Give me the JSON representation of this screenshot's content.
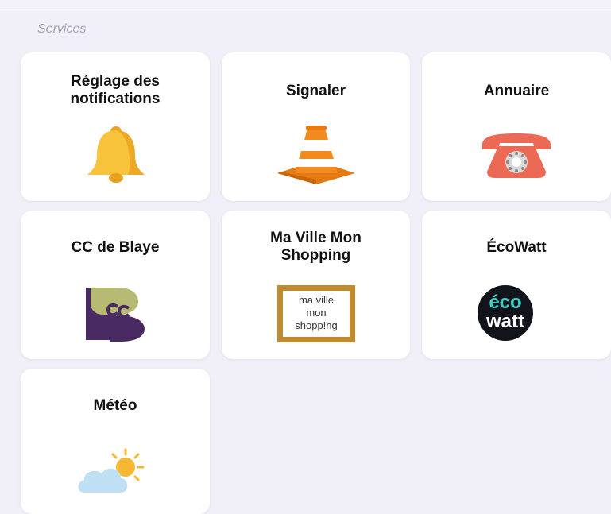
{
  "section": {
    "title": "Services"
  },
  "cards": [
    {
      "id": "notifications",
      "title_line1": "Réglage des",
      "title_line2": "notifications",
      "icon": "bell-icon"
    },
    {
      "id": "signaler",
      "title": "Signaler",
      "icon": "traffic-cone-icon"
    },
    {
      "id": "annuaire",
      "title": "Annuaire",
      "icon": "telephone-icon"
    },
    {
      "id": "cc-blaye",
      "title": "CC de Blaye",
      "icon": "cc-blaye-logo"
    },
    {
      "id": "ma-ville",
      "title_line1": "Ma Ville Mon",
      "title_line2": "Shopping",
      "icon": "ma-ville-mon-shopping-logo",
      "logo_lines": [
        "ma ville",
        "mon",
        "shopp!ng"
      ]
    },
    {
      "id": "ecowatt",
      "title": "ÉcoWatt",
      "icon": "ecowatt-logo",
      "logo_lines": [
        "éco",
        "watt"
      ]
    },
    {
      "id": "meteo",
      "title": "Météo",
      "icon": "weather-sun-cloud-icon"
    }
  ],
  "colors": {
    "background": "#f1f0f8",
    "card": "#ffffff",
    "bell": "#f5b82e",
    "cone": "#f28a1e",
    "phone": "#ec6a55",
    "cc_purple": "#4a2a63",
    "cc_green": "#b7ba72",
    "ecowatt_dark": "#11141a",
    "ecowatt_teal": "#3fd1c5",
    "shopping_frame": "#c18a2c"
  }
}
